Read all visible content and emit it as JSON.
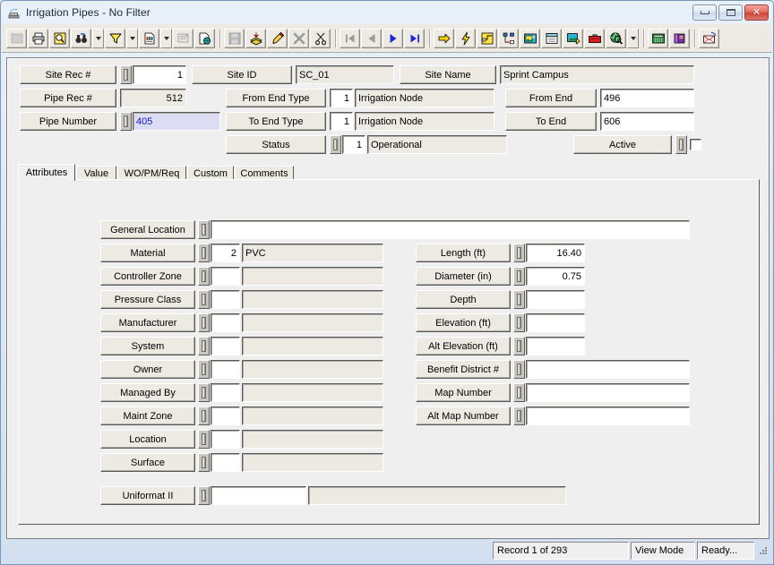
{
  "window": {
    "title": "Irrigation Pipes - No Filter",
    "icon": "pipe-icon",
    "controls": {
      "minimize": "minimize-button",
      "maximize": "maximize-button",
      "close": "close-button",
      "close_glyph": "✕"
    }
  },
  "toolbar": {
    "groups": [
      {
        "items": [
          {
            "name": "select-grid-icon",
            "dropdown": false,
            "disabled": true
          },
          {
            "name": "print-icon",
            "dropdown": false,
            "disabled": false
          },
          {
            "name": "print-preview-icon",
            "dropdown": false,
            "disabled": false
          },
          {
            "name": "find-icon",
            "dropdown": true,
            "disabled": false
          },
          {
            "name": "filter-icon",
            "dropdown": true,
            "disabled": false
          },
          {
            "name": "report-icon",
            "dropdown": true,
            "disabled": false
          },
          {
            "name": "form-design-icon",
            "dropdown": false,
            "disabled": true
          },
          {
            "name": "copy-record-icon",
            "dropdown": false,
            "disabled": false
          }
        ]
      },
      {
        "items": [
          {
            "name": "save-icon",
            "dropdown": false,
            "disabled": true
          },
          {
            "name": "add-record-icon",
            "dropdown": false,
            "disabled": false
          },
          {
            "name": "edit-record-icon",
            "dropdown": false,
            "disabled": false
          },
          {
            "name": "delete-record-icon",
            "dropdown": false,
            "disabled": true
          },
          {
            "name": "cut-icon",
            "dropdown": false,
            "disabled": false
          }
        ]
      },
      {
        "items": [
          {
            "name": "first-record-icon",
            "dropdown": false,
            "disabled": true
          },
          {
            "name": "previous-record-icon",
            "dropdown": false,
            "disabled": true
          },
          {
            "name": "next-record-icon",
            "dropdown": false,
            "disabled": false
          },
          {
            "name": "last-record-icon",
            "dropdown": false,
            "disabled": false
          }
        ]
      },
      {
        "items": [
          {
            "name": "goto-icon",
            "dropdown": false,
            "disabled": false
          },
          {
            "name": "action-icon",
            "dropdown": false,
            "disabled": false
          },
          {
            "name": "cad-icon",
            "dropdown": false,
            "disabled": false
          },
          {
            "name": "hierarchy-icon",
            "dropdown": false,
            "disabled": false
          },
          {
            "name": "image-icon",
            "dropdown": false,
            "disabled": false
          },
          {
            "name": "calendar-icon",
            "dropdown": false,
            "disabled": false
          },
          {
            "name": "photo-edit-icon",
            "dropdown": false,
            "disabled": false
          },
          {
            "name": "toolbox-icon",
            "dropdown": false,
            "disabled": false
          },
          {
            "name": "web-search-icon",
            "dropdown": true,
            "disabled": false
          }
        ]
      },
      {
        "items": [
          {
            "name": "calculator-icon",
            "dropdown": false,
            "disabled": false
          },
          {
            "name": "help-book-icon",
            "dropdown": false,
            "disabled": false
          }
        ]
      },
      {
        "items": [
          {
            "name": "mail-icon",
            "dropdown": false,
            "disabled": false
          }
        ]
      }
    ]
  },
  "header": {
    "site_rec": {
      "label": "Site Rec #",
      "value": "1"
    },
    "site_id": {
      "label": "Site ID",
      "value": "SC_01"
    },
    "site_name": {
      "label": "Site Name",
      "value": "Sprint Campus"
    },
    "pipe_rec": {
      "label": "Pipe Rec #",
      "value": "512"
    },
    "pipe_number": {
      "label": "Pipe Number",
      "value": "405"
    },
    "from_end_type": {
      "label": "From End Type",
      "code": "1",
      "value": "Irrigation Node"
    },
    "to_end_type": {
      "label": "To End Type",
      "code": "1",
      "value": "Irrigation Node"
    },
    "status": {
      "label": "Status",
      "code": "1",
      "value": "Operational"
    },
    "from_end": {
      "label": "From End",
      "value": "496"
    },
    "to_end": {
      "label": "To End",
      "value": "606"
    },
    "active": {
      "label": "Active",
      "checked": false
    }
  },
  "tabs": [
    {
      "label": "Attributes",
      "selected": true
    },
    {
      "label": "Value",
      "selected": false
    },
    {
      "label": "WO/PM/Req",
      "selected": false
    },
    {
      "label": "Custom",
      "selected": false
    },
    {
      "label": "Comments",
      "selected": false
    }
  ],
  "attributes": {
    "left_fields": [
      {
        "label": "General Location",
        "code": "",
        "value": "",
        "kind": "wide"
      },
      {
        "label": "Material",
        "code": "2",
        "value": "PVC",
        "kind": "code"
      },
      {
        "label": "Controller Zone",
        "code": "",
        "value": "",
        "kind": "code"
      },
      {
        "label": "Pressure Class",
        "code": "",
        "value": "",
        "kind": "code"
      },
      {
        "label": "Manufacturer",
        "code": "",
        "value": "",
        "kind": "code"
      },
      {
        "label": "System",
        "code": "",
        "value": "",
        "kind": "code"
      },
      {
        "label": "Owner",
        "code": "",
        "value": "",
        "kind": "code"
      },
      {
        "label": "Managed By",
        "code": "",
        "value": "",
        "kind": "code"
      },
      {
        "label": "Maint Zone",
        "code": "",
        "value": "",
        "kind": "code"
      },
      {
        "label": "Location",
        "code": "",
        "value": "",
        "kind": "code"
      },
      {
        "label": "Surface",
        "code": "",
        "value": "",
        "kind": "code"
      }
    ],
    "uniformat": {
      "label": "Uniformat II",
      "code": "",
      "value": ""
    },
    "right_fields": [
      {
        "label": "Length (ft)",
        "value": "16.40",
        "kind": "num"
      },
      {
        "label": "Diameter (in)",
        "value": "0.75",
        "kind": "num"
      },
      {
        "label": "Depth",
        "value": "",
        "kind": "num"
      },
      {
        "label": "Elevation (ft)",
        "value": "",
        "kind": "num"
      },
      {
        "label": "Alt Elevation (ft)",
        "value": "",
        "kind": "num"
      },
      {
        "label": "Benefit District #",
        "value": "",
        "kind": "long"
      },
      {
        "label": "Map Number",
        "value": "",
        "kind": "long"
      },
      {
        "label": "Alt Map Number",
        "value": "",
        "kind": "long"
      }
    ]
  },
  "statusbar": {
    "record": "Record 1 of 293",
    "mode": "View Mode",
    "state": "Ready..."
  }
}
